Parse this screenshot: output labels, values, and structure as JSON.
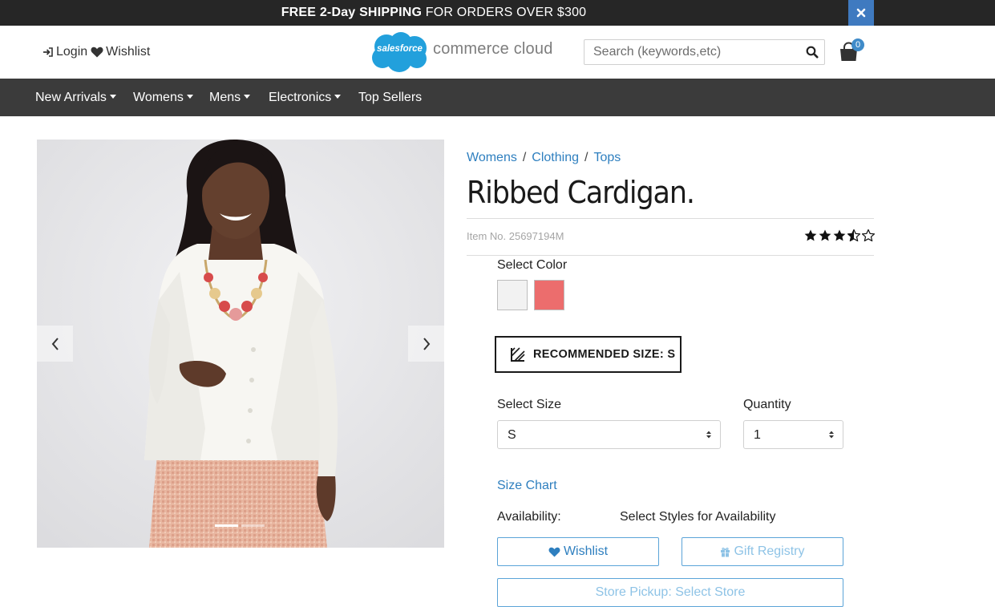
{
  "promo": {
    "bold_lead": "FREE 2-Day",
    "bold_shipping": "SHIPPING",
    "rest": "FOR ORDERS OVER $300",
    "close_icon": "close-icon"
  },
  "header": {
    "login_label": "Login",
    "wishlist_label": "Wishlist",
    "logo_cloud_text": "salesforce",
    "logo_text": "commerce cloud",
    "search_placeholder": "Search (keywords,etc)",
    "cart_count": "0"
  },
  "nav": {
    "items": [
      {
        "label": "New Arrivals",
        "dropdown": true
      },
      {
        "label": "Womens",
        "dropdown": true
      },
      {
        "label": "Mens",
        "dropdown": true
      },
      {
        "label": "Electronics",
        "dropdown": true
      },
      {
        "label": "Top Sellers",
        "dropdown": false
      }
    ]
  },
  "gallery": {
    "slide_count": 2,
    "active_slide": 1
  },
  "product": {
    "breadcrumbs": [
      "Womens",
      "Clothing",
      "Tops"
    ],
    "name": "Ribbed Cardigan.",
    "item_no": "Item No. 25697194M",
    "rating": 3.5,
    "rating_max": 5,
    "select_color_label": "Select Color",
    "colors": [
      {
        "name": "white",
        "hex": "#f2f2f2"
      },
      {
        "name": "coral",
        "hex": "#ec6d6d"
      }
    ],
    "recommended_size_label": "RECOMMENDED SIZE: S",
    "select_size_label": "Select Size",
    "size_value": "S",
    "quantity_label": "Quantity",
    "quantity_value": "1",
    "size_chart_label": "Size Chart",
    "availability_label": "Availability:",
    "availability_value": "Select Styles for Availability",
    "wishlist_button": "Wishlist",
    "gift_registry_button": "Gift Registry",
    "store_pickup_button": "Store Pickup: Select Store"
  },
  "colors": {
    "link": "#2e7fbf",
    "nav_bg": "#3b3b3b",
    "promo_bg": "#262626",
    "close_bg": "#3f7ac0",
    "button_border": "#5ba4d8",
    "disabled_text": "#8ec3e6"
  }
}
